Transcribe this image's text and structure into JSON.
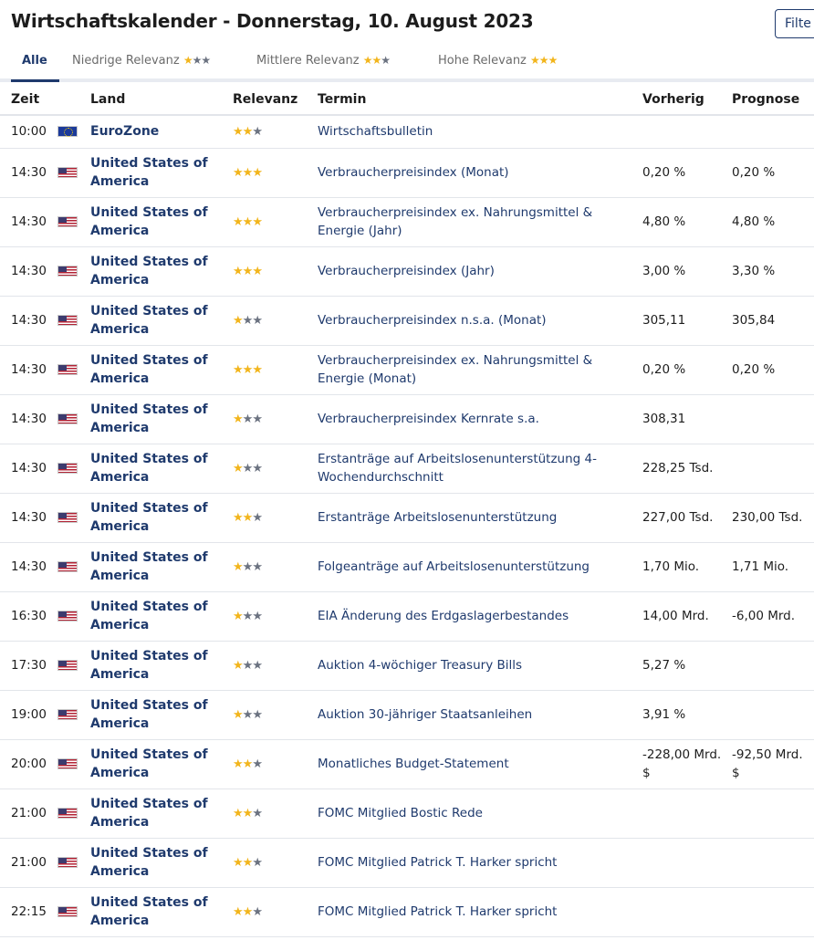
{
  "header": {
    "title": "Wirtschaftskalender - Donnerstag, 10. August 2023",
    "filter_label": "Filte"
  },
  "colors": {
    "accent": "#1f3a6d",
    "star_on": "#f2b51c",
    "star_off": "#6b7280"
  },
  "tabs": [
    {
      "label": "Alle",
      "stars_on": 0,
      "active": true
    },
    {
      "label": "Niedrige Relevanz",
      "stars_on": 1,
      "active": false
    },
    {
      "label": "Mittlere Relevanz",
      "stars_on": 2,
      "active": false
    },
    {
      "label": "Hohe Relevanz",
      "stars_on": 3,
      "active": false
    }
  ],
  "table": {
    "columns": [
      "Zeit",
      "Land",
      "Relevanz",
      "Termin",
      "Vorherig",
      "Prognose"
    ],
    "rows": [
      {
        "time": "10:00",
        "flag": "eu-flag-icon",
        "land": "EuroZone",
        "relevance": 2,
        "termin": "Wirtschaftsbulletin",
        "vorherig": "",
        "prognose": ""
      },
      {
        "time": "14:30",
        "flag": "us-flag-icon",
        "land": "United States of America",
        "relevance": 3,
        "termin": "Verbraucherpreisindex (Monat)",
        "vorherig": "0,20 %",
        "prognose": "0,20 %"
      },
      {
        "time": "14:30",
        "flag": "us-flag-icon",
        "land": "United States of America",
        "relevance": 3,
        "termin": "Verbraucherpreisindex ex. Nahrungsmittel & Energie (Jahr)",
        "vorherig": "4,80 %",
        "prognose": "4,80 %"
      },
      {
        "time": "14:30",
        "flag": "us-flag-icon",
        "land": "United States of America",
        "relevance": 3,
        "termin": "Verbraucherpreisindex (Jahr)",
        "vorherig": "3,00 %",
        "prognose": "3,30 %"
      },
      {
        "time": "14:30",
        "flag": "us-flag-icon",
        "land": "United States of America",
        "relevance": 1,
        "termin": "Verbraucherpreisindex n.s.a. (Monat)",
        "vorherig": "305,11",
        "prognose": "305,84"
      },
      {
        "time": "14:30",
        "flag": "us-flag-icon",
        "land": "United States of America",
        "relevance": 3,
        "termin": "Verbraucherpreisindex ex. Nahrungsmittel & Energie (Monat)",
        "vorherig": "0,20 %",
        "prognose": "0,20 %"
      },
      {
        "time": "14:30",
        "flag": "us-flag-icon",
        "land": "United States of America",
        "relevance": 1,
        "termin": "Verbraucherpreisindex Kernrate s.a.",
        "vorherig": "308,31",
        "prognose": ""
      },
      {
        "time": "14:30",
        "flag": "us-flag-icon",
        "land": "United States of America",
        "relevance": 1,
        "termin": "Erstanträge auf Arbeitslosenunterstützung 4-Wochendurchschnitt",
        "vorherig": "228,25 Tsd.",
        "prognose": ""
      },
      {
        "time": "14:30",
        "flag": "us-flag-icon",
        "land": "United States of America",
        "relevance": 2,
        "termin": "Erstanträge Arbeitslosenunterstützung",
        "vorherig": "227,00 Tsd.",
        "prognose": "230,00 Tsd."
      },
      {
        "time": "14:30",
        "flag": "us-flag-icon",
        "land": "United States of America",
        "relevance": 1,
        "termin": "Folgeanträge auf Arbeitslosenunterstützung",
        "vorherig": "1,70 Mio.",
        "prognose": "1,71 Mio."
      },
      {
        "time": "16:30",
        "flag": "us-flag-icon",
        "land": "United States of America",
        "relevance": 1,
        "termin": "EIA Änderung des Erdgaslagerbestandes",
        "vorherig": "14,00 Mrd.",
        "prognose": "-6,00 Mrd."
      },
      {
        "time": "17:30",
        "flag": "us-flag-icon",
        "land": "United States of America",
        "relevance": 1,
        "termin": "Auktion 4-wöchiger Treasury Bills",
        "vorherig": "5,27 %",
        "prognose": ""
      },
      {
        "time": "19:00",
        "flag": "us-flag-icon",
        "land": "United States of America",
        "relevance": 1,
        "termin": "Auktion 30-jähriger Staatsanleihen",
        "vorherig": "3,91 %",
        "prognose": ""
      },
      {
        "time": "20:00",
        "flag": "us-flag-icon",
        "land": "United States of America",
        "relevance": 2,
        "termin": "Monatliches Budget-Statement",
        "vorherig": "-228,00 Mrd. $",
        "prognose": "-92,50 Mrd. $"
      },
      {
        "time": "21:00",
        "flag": "us-flag-icon",
        "land": "United States of America",
        "relevance": 2,
        "termin": "FOMC Mitglied Bostic Rede",
        "vorherig": "",
        "prognose": ""
      },
      {
        "time": "21:00",
        "flag": "us-flag-icon",
        "land": "United States of America",
        "relevance": 2,
        "termin": "FOMC Mitglied Patrick T. Harker spricht",
        "vorherig": "",
        "prognose": ""
      },
      {
        "time": "22:15",
        "flag": "us-flag-icon",
        "land": "United States of America",
        "relevance": 2,
        "termin": "FOMC Mitglied Patrick T. Harker spricht",
        "vorherig": "",
        "prognose": ""
      }
    ]
  }
}
